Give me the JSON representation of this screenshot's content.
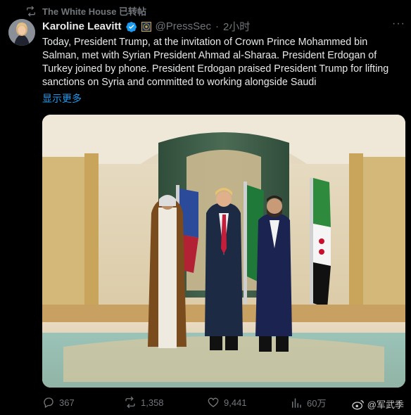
{
  "repost": {
    "label": "The White House 已转帖"
  },
  "author": {
    "name": "Karoline Leavitt",
    "handle": "@PressSec",
    "separator": "·",
    "time": "2小时"
  },
  "tweet": {
    "text": "Today, President Trump, at the invitation of Crown Prince Mohammed bin Salman, met with Syrian President Ahmad al-Sharaa. President Erdogan of Turkey joined by phone. President Erdogan praised President Trump for lifting sanctions on Syria and committed to working alongside Saudi",
    "show_more": "显示更多"
  },
  "actions": {
    "replies": "367",
    "reposts": "1,358",
    "likes": "9,441",
    "views": "60万"
  },
  "watermark": {
    "text": "@军武季"
  },
  "icons": [
    "repost-icon",
    "verified-badge-icon",
    "affiliate-badge-icon",
    "more-icon",
    "reply-icon",
    "like-icon",
    "views-icon",
    "weibo-logo-icon"
  ],
  "colors": {
    "background": "#000000",
    "text": "#e7e9ea",
    "muted": "#71767b",
    "link": "#1d9bf0",
    "verified": "#1d9bf0"
  }
}
